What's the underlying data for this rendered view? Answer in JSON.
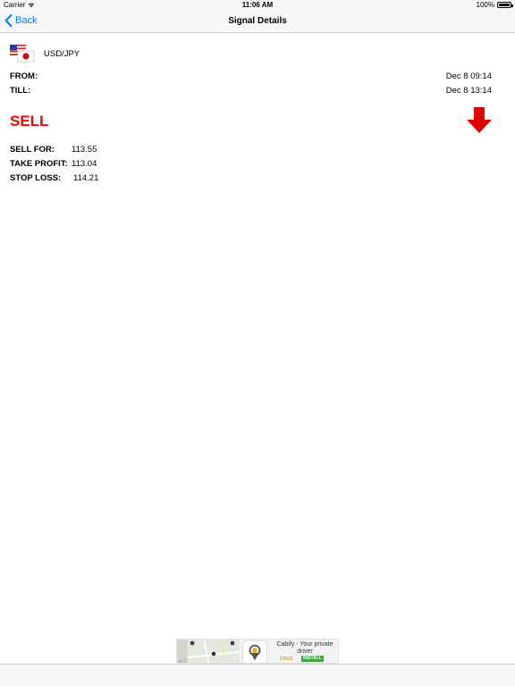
{
  "status_bar": {
    "carrier": "Carrier",
    "time": "11:06 AM",
    "battery": "100%"
  },
  "nav": {
    "back_label": "Back",
    "title": "Signal Details"
  },
  "signal": {
    "pair": "USD/JPY",
    "from_label": "FROM:",
    "from_value": "Dec 8 09:14",
    "till_label": "TILL:",
    "till_value": "Dec 8 13:14",
    "action": "SELL",
    "action_color": "#ff0000",
    "arrow_icon": "arrow-down-icon",
    "sell_for_label": "SELL FOR:",
    "sell_for_value": "113.55",
    "take_profit_label": "TAKE PROFIT:",
    "take_profit_value": "113.04",
    "stop_loss_label": "STOP LOSS:",
    "stop_loss_value": "114.21"
  },
  "ad": {
    "title": "Cabify - Your private driver",
    "price": "FREE",
    "install_label": "INSTALL"
  },
  "colors": {
    "accent": "#007aff",
    "sell": "#ff0000",
    "install": "#3da63d"
  }
}
